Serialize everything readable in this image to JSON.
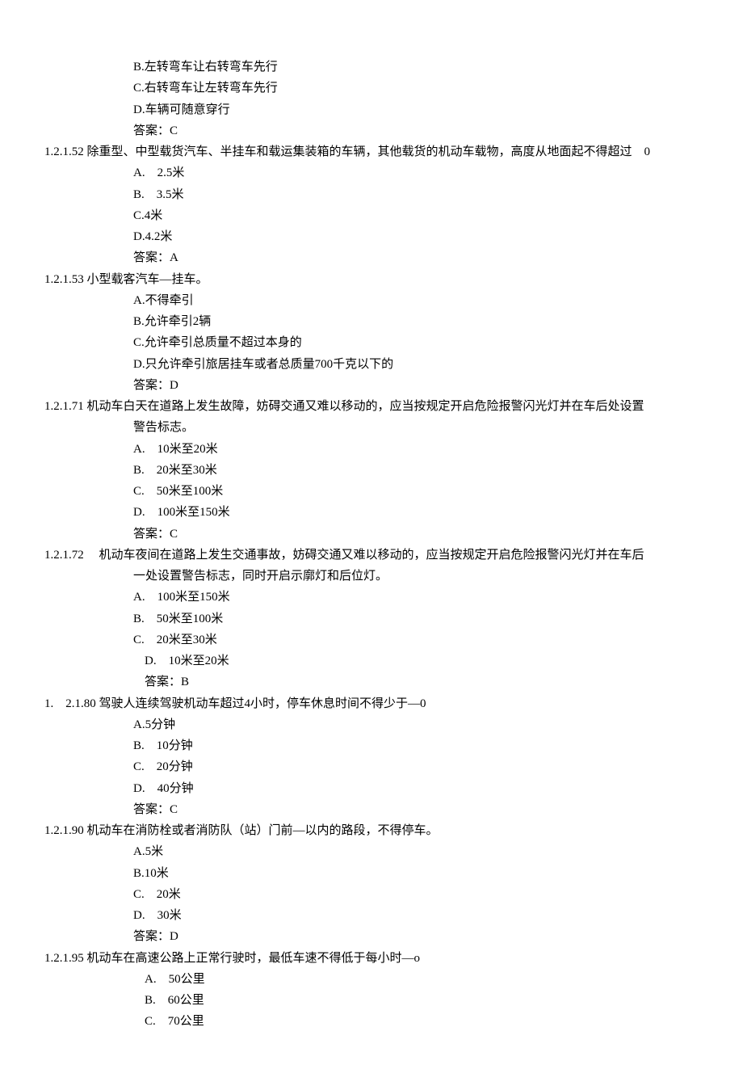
{
  "pre_options": {
    "b": "B.左转弯车让右转弯车先行",
    "c": "C.右转弯车让左转弯车先行",
    "d": "D.车辆可随意穿行",
    "ans": "答案：C"
  },
  "q52": {
    "num": "1.2.1.52",
    "stem": "除重型、中型载货汽车、半挂车和载运集装箱的车辆，其他载货的机动车载物，高度从地面起不得超过　0",
    "a": "A.　2.5米",
    "b": "B.　3.5米",
    "c": "C.4米",
    "d": "D.4.2米",
    "ans": "答案：A"
  },
  "q53": {
    "num": "1.2.1.53",
    "stem": "小型载客汽车—挂车。",
    "a": "A.不得牵引",
    "b": "B.允许牵引2辆",
    "c": "C.允许牵引总质量不超过本身的",
    "d": "D.只允许牵引旅居挂车或者总质量700千克以下的",
    "ans": "答案：D"
  },
  "q71": {
    "num": "1.2.1.71",
    "stem1": "机动车白天在道路上发生故障，妨碍交通又难以移动的，应当按规定开启危险报警闪光灯并在车后处设置",
    "stem2": "警告标志。",
    "a": "A.　10米至20米",
    "b": "B.　20米至30米",
    "c": "C.　50米至100米",
    "d": "D.　100米至150米",
    "ans": "答案：C"
  },
  "q72": {
    "num": "1.2.1.72　",
    "stem1": "机动车夜间在道路上发生交通事故，妨碍交通又难以移动的，应当按规定开启危险报警闪光灯并在车后",
    "stem2": "一处设置警告标志，同时开启示廓灯和后位灯。",
    "a": "A.　100米至150米",
    "b": "B.　50米至100米",
    "c": "C.　20米至30米",
    "d": "D.　10米至20米",
    "ans": "答案：B"
  },
  "q80": {
    "num": "1.　2.1.80",
    "stem": "驾驶人连续驾驶机动车超过4小时，停车休息时间不得少于—0",
    "a": "A.5分钟",
    "b": "B.　10分钟",
    "c": "C.　20分钟",
    "d": "D.　40分钟",
    "ans": "答案：C"
  },
  "q90": {
    "num": "1.2.1.90",
    "stem": "机动车在消防栓或者消防队（站）门前—以内的路段，不得停车。",
    "a": "A.5米",
    "b": "B.10米",
    "c": "C.　20米",
    "d": "D.　30米",
    "ans": "答案：D"
  },
  "q95": {
    "num": "1.2.1.95",
    "stem": "机动车在高速公路上正常行驶时，最低车速不得低于每小时—o",
    "a": "A.　50公里",
    "b": "B.　60公里",
    "c": "C.　70公里"
  }
}
